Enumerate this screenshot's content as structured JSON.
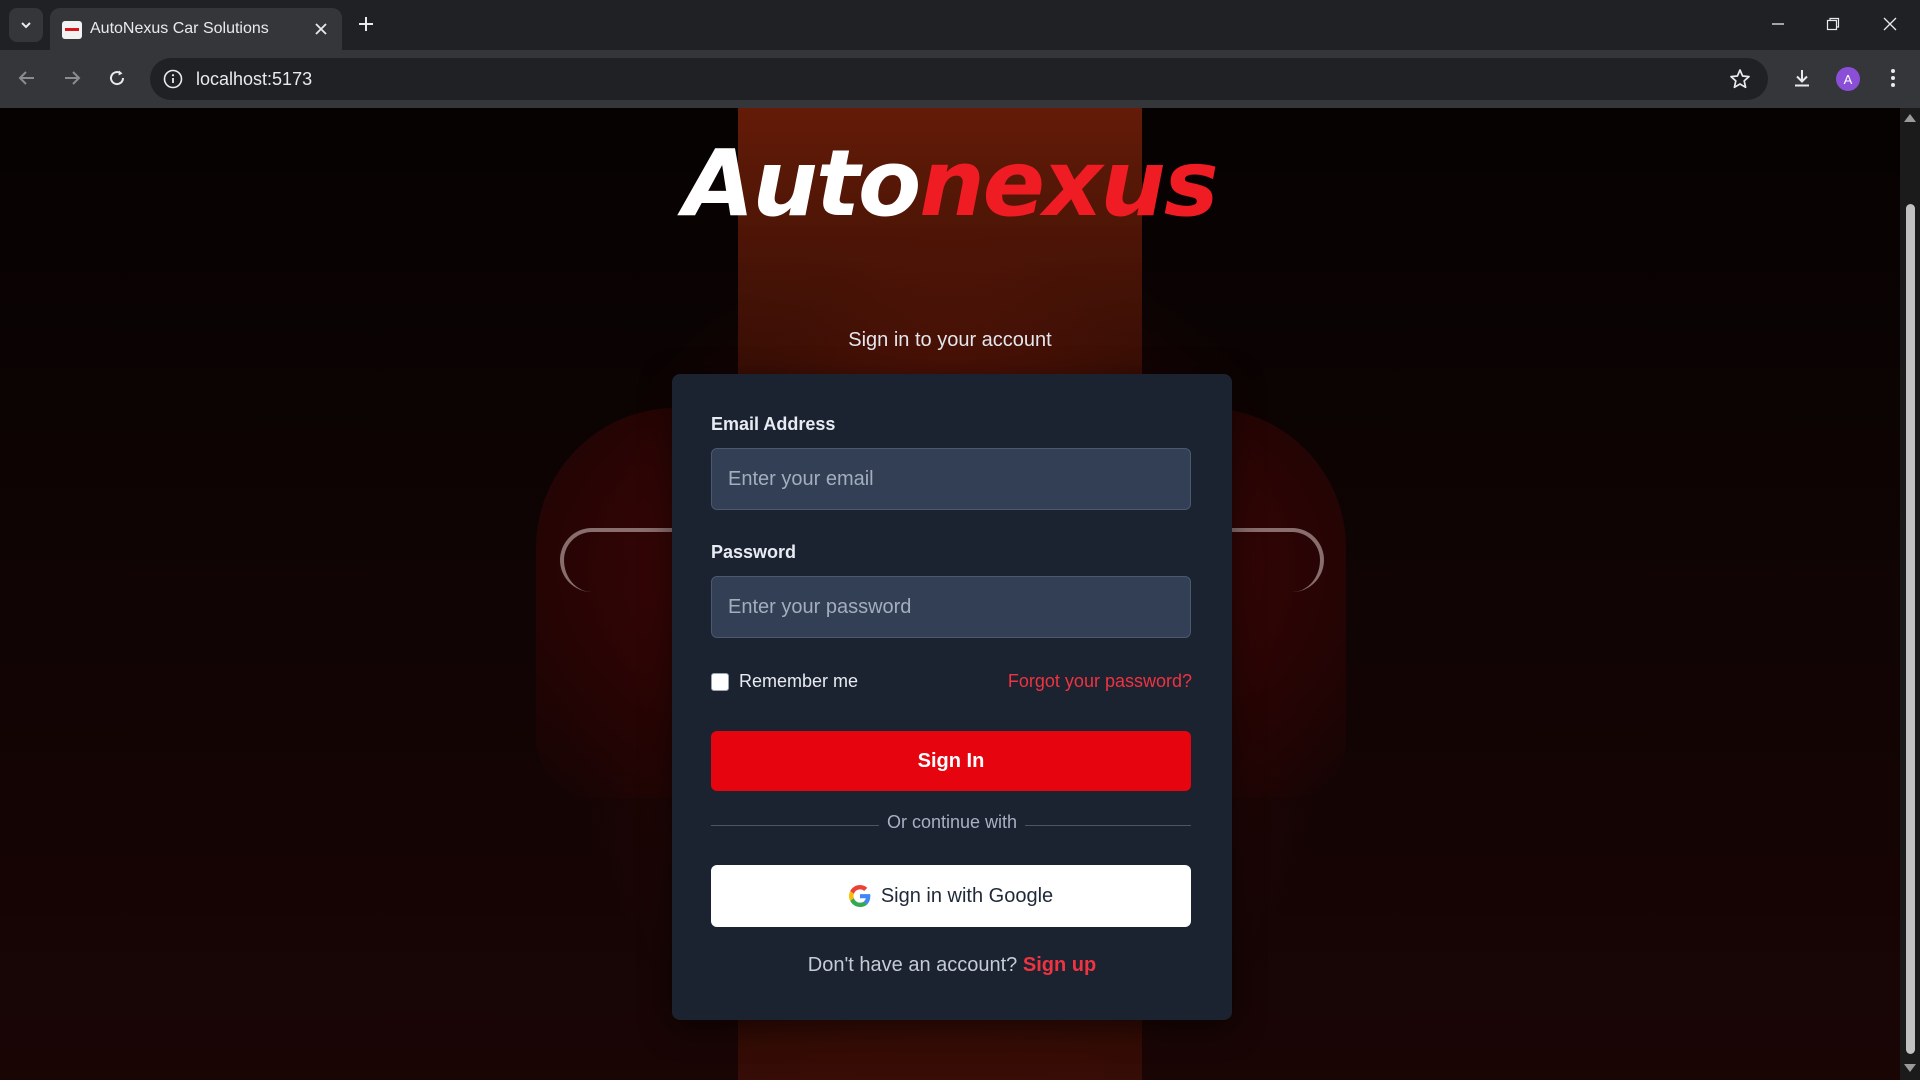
{
  "browser": {
    "tab_title": "AutoNexus Car Solutions",
    "url": "localhost:5173",
    "profile_initial": "A",
    "icons": {
      "tab_list": "chevron-down-icon",
      "tab_close": "close-icon",
      "new_tab": "plus-icon",
      "minimize": "minimize-icon",
      "restore": "restore-icon",
      "close_window": "close-icon",
      "back": "arrow-left-icon",
      "forward": "arrow-right-icon",
      "reload": "reload-icon",
      "site_info": "info-icon",
      "bookmark": "star-icon",
      "download": "download-icon",
      "menu": "kebab-menu-icon"
    }
  },
  "brand": {
    "logo_part1": "Auto",
    "logo_part2": "nexus",
    "logo_part1_color": "#ffffff",
    "logo_part2_color": "#ef1c24"
  },
  "login": {
    "subtitle": "Sign in to your account",
    "email_label": "Email Address",
    "email_placeholder": "Enter your email",
    "email_value": "",
    "password_label": "Password",
    "password_placeholder": "Enter your password",
    "password_value": "",
    "remember_label": "Remember me",
    "remember_checked": false,
    "forgot_link": "Forgot your password?",
    "signin_button": "Sign In",
    "divider_text": "Or continue with",
    "google_button": "Sign in with Google",
    "signup_prompt": "Don't have an account?",
    "signup_link": "Sign up"
  },
  "colors": {
    "accent": "#e6040f",
    "card_bg": "#1b2230",
    "input_bg": "#323f55",
    "link": "#ef3340"
  }
}
